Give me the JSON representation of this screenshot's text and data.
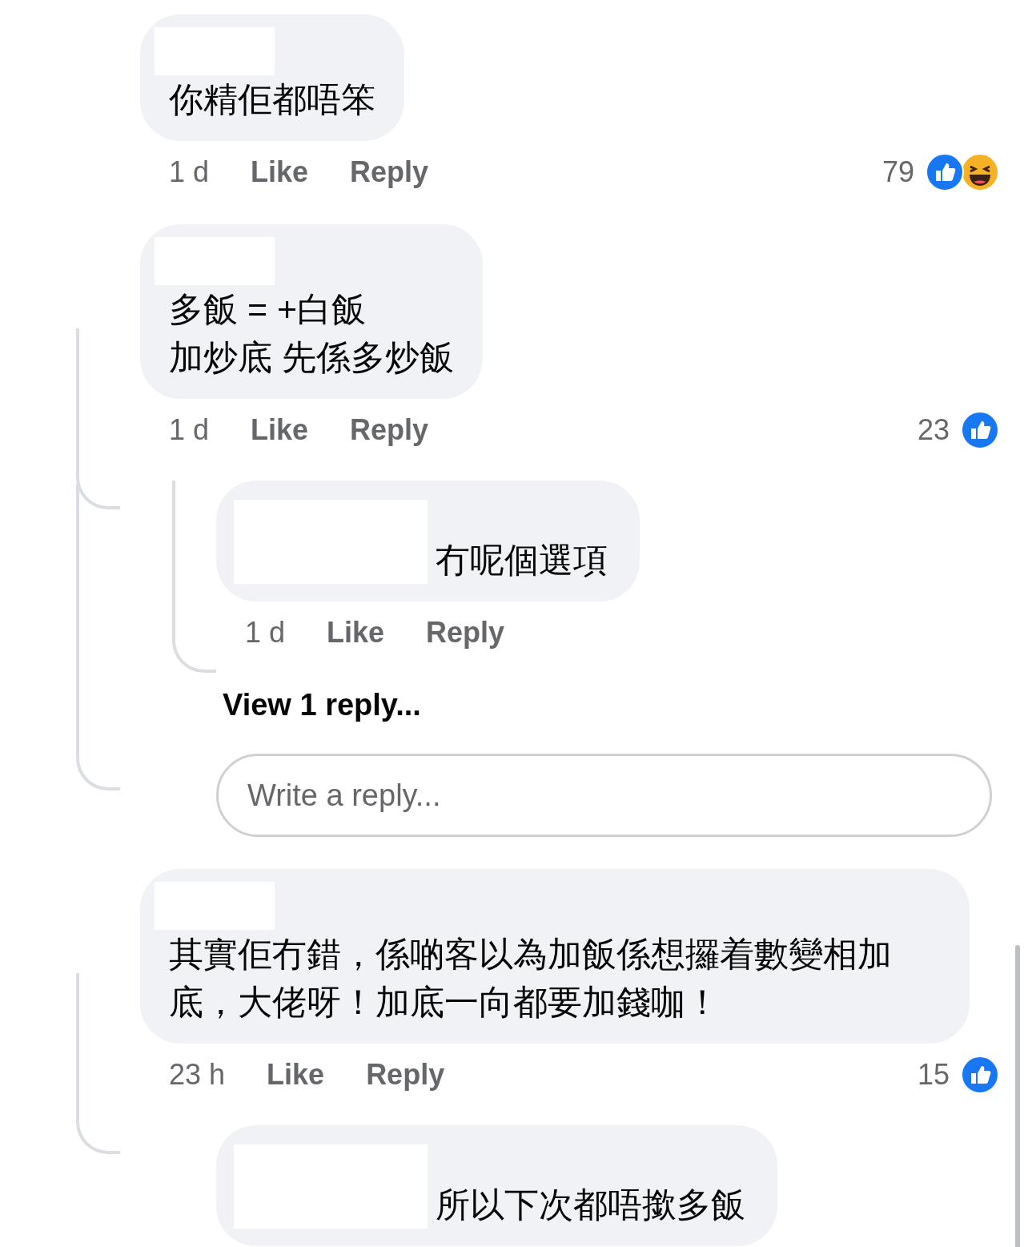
{
  "comments": [
    {
      "text": [
        "你精佢都唔笨"
      ],
      "time": "1 d",
      "like": "Like",
      "reply": "Reply",
      "reaction_count": "79",
      "reactions": [
        {
          "kind": "like"
        },
        {
          "kind": "haha"
        }
      ]
    },
    {
      "text": [
        "多飯 = +白飯",
        "加炒底 先係多炒飯"
      ],
      "time": "1 d",
      "like": "Like",
      "reply": "Reply",
      "reaction_count": "23",
      "reactions": [
        {
          "kind": "like"
        }
      ],
      "replies": [
        {
          "text": [
            "冇呢個選項"
          ],
          "time": "1 d",
          "like": "Like",
          "reply": "Reply",
          "view_replies": "View 1 reply..."
        }
      ],
      "reply_field": {
        "placeholder": "Write a reply..."
      }
    },
    {
      "text": [
        "其實佢冇錯，係啲客以為加飯係想攞着數變相加底，大佬呀！加底一向都要加錢咖！"
      ],
      "time": "23 h",
      "like": "Like",
      "reply": "Reply",
      "reaction_count": "15",
      "reactions": [
        {
          "kind": "like"
        }
      ],
      "replies": [
        {
          "text": [
            "所以下次都唔撳多飯"
          ]
        }
      ]
    }
  ]
}
